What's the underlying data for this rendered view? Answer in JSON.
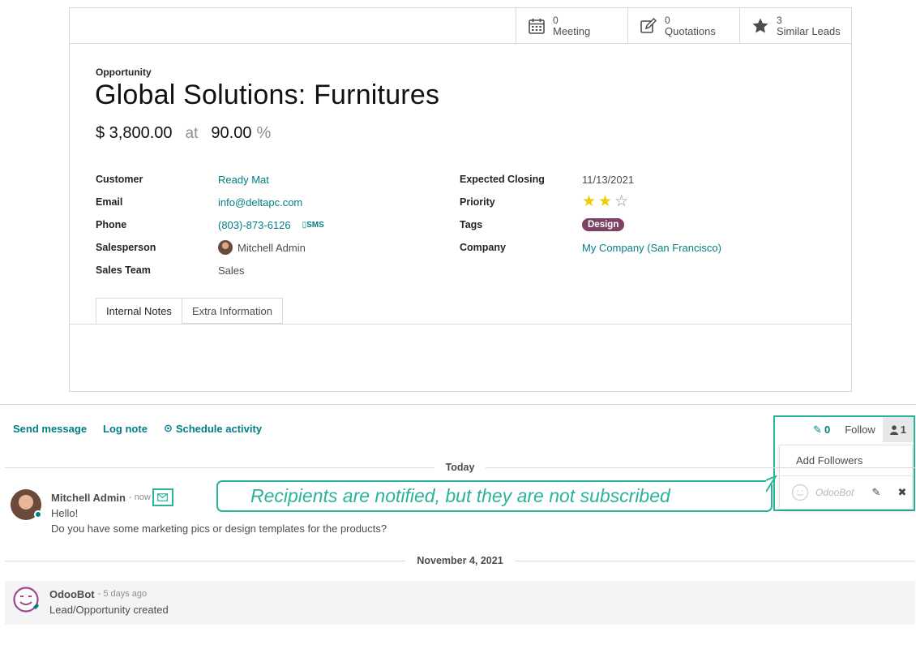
{
  "stat_buttons": [
    {
      "value": "0",
      "label": "Meeting",
      "icon": "calendar-icon"
    },
    {
      "value": "0",
      "label": "Quotations",
      "icon": "edit-icon"
    },
    {
      "value": "3",
      "label": "Similar Leads",
      "icon": "star-icon"
    }
  ],
  "record": {
    "kind": "Opportunity",
    "title": "Global Solutions: Furnitures",
    "revenue": "$ 3,800.00",
    "at": "at",
    "probability": "90.00",
    "pct_sign": "%"
  },
  "left_fields": {
    "customer_label": "Customer",
    "customer": "Ready Mat",
    "email_label": "Email",
    "email": "info@deltapc.com",
    "phone_label": "Phone",
    "phone": "(803)-873-6126",
    "sms": "SMS",
    "salesperson_label": "Salesperson",
    "salesperson": "Mitchell Admin",
    "team_label": "Sales Team",
    "team": "Sales"
  },
  "right_fields": {
    "closing_label": "Expected Closing",
    "closing": "11/13/2021",
    "priority_label": "Priority",
    "priority_stars": 2,
    "priority_max": 3,
    "tags_label": "Tags",
    "tag": "Design",
    "tag_color": "#7b4265",
    "company_label": "Company",
    "company": "My Company (San Francisco)"
  },
  "tabs": [
    "Internal Notes",
    "Extra Information"
  ],
  "chatter": {
    "send_message": "Send message",
    "log_note": "Log note",
    "schedule_activity": "Schedule activity",
    "attachments_count": "0",
    "follow": "Follow",
    "followers_count": "1",
    "add_followers": "Add Followers",
    "follower_name": "OdooBot"
  },
  "callout": "Recipients are notified, but they are not subscribed",
  "date_today": "Today",
  "date_nov": "November 4, 2021",
  "messages": [
    {
      "author": "Mitchell Admin",
      "time": "- now",
      "line1": "Hello!",
      "line2": "Do you have some marketing pics or design templates for the products?"
    },
    {
      "author": "OdooBot",
      "time": "- 5 days ago",
      "line1": "Lead/Opportunity created"
    }
  ],
  "colors": {
    "accent": "#017e84",
    "highlight": "#2ab397",
    "tag": "#7b4265"
  }
}
